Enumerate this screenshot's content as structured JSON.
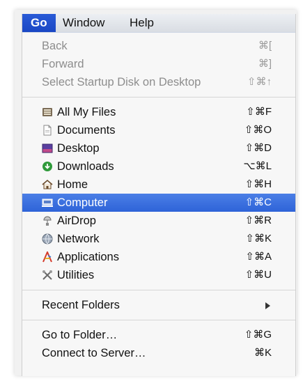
{
  "menubar": {
    "go": "Go",
    "window": "Window",
    "help": "Help"
  },
  "menu": {
    "nav": [
      {
        "label": "Back",
        "shortcut": "⌘[",
        "enabled": false
      },
      {
        "label": "Forward",
        "shortcut": "⌘]",
        "enabled": false
      },
      {
        "label": "Select Startup Disk on Desktop",
        "shortcut": "⇧⌘↑",
        "enabled": false
      }
    ],
    "places": [
      {
        "label": "All My Files",
        "shortcut": "⇧⌘F",
        "icon": "all-my-files-icon"
      },
      {
        "label": "Documents",
        "shortcut": "⇧⌘O",
        "icon": "documents-icon"
      },
      {
        "label": "Desktop",
        "shortcut": "⇧⌘D",
        "icon": "desktop-icon"
      },
      {
        "label": "Downloads",
        "shortcut": "⌥⌘L",
        "icon": "downloads-icon"
      },
      {
        "label": "Home",
        "shortcut": "⇧⌘H",
        "icon": "home-icon"
      },
      {
        "label": "Computer",
        "shortcut": "⇧⌘C",
        "icon": "computer-icon",
        "selected": true
      },
      {
        "label": "AirDrop",
        "shortcut": "⇧⌘R",
        "icon": "airdrop-icon"
      },
      {
        "label": "Network",
        "shortcut": "⇧⌘K",
        "icon": "network-icon"
      },
      {
        "label": "Applications",
        "shortcut": "⇧⌘A",
        "icon": "applications-icon"
      },
      {
        "label": "Utilities",
        "shortcut": "⇧⌘U",
        "icon": "utilities-icon"
      }
    ],
    "recent_folders": "Recent Folders",
    "footer": [
      {
        "label": "Go to Folder…",
        "shortcut": "⇧⌘G"
      },
      {
        "label": "Connect to Server…",
        "shortcut": "⌘K"
      }
    ]
  },
  "colors": {
    "selection": "#2e63d8",
    "menubar_active": "#1a47c4",
    "disabled_text": "#8d8d8d"
  }
}
